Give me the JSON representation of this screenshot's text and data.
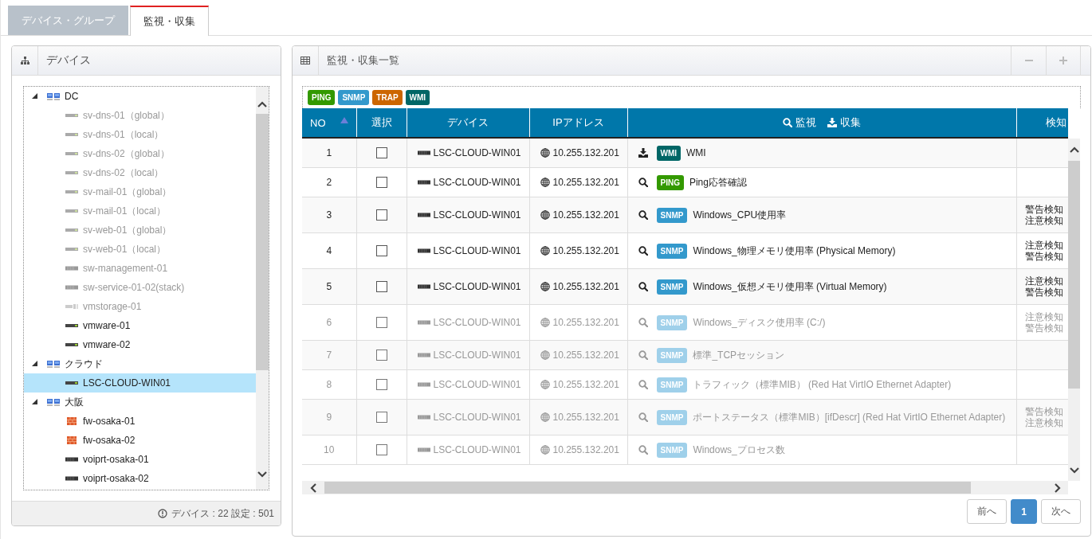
{
  "tabs": [
    {
      "label": "デバイス・グループ",
      "selected": false
    },
    {
      "label": "監視・収集",
      "selected": true
    }
  ],
  "device_panel": {
    "title": "デバイス",
    "tree": [
      {
        "label": "DC",
        "kind": "group",
        "expanded": true,
        "selected": false,
        "disabled": false,
        "children": [
          {
            "label": "sv-dns-01（global）",
            "kind": "server",
            "selected": false,
            "disabled": true
          },
          {
            "label": "sv-dns-01（local）",
            "kind": "server",
            "selected": false,
            "disabled": true
          },
          {
            "label": "sv-dns-02（global）",
            "kind": "server",
            "selected": false,
            "disabled": true
          },
          {
            "label": "sv-dns-02（local）",
            "kind": "server",
            "selected": false,
            "disabled": true
          },
          {
            "label": "sv-mail-01（global）",
            "kind": "server",
            "selected": false,
            "disabled": true
          },
          {
            "label": "sv-mail-01（local）",
            "kind": "server",
            "selected": false,
            "disabled": true
          },
          {
            "label": "sv-web-01（global）",
            "kind": "server",
            "selected": false,
            "disabled": true
          },
          {
            "label": "sv-web-01（local）",
            "kind": "server",
            "selected": false,
            "disabled": true
          },
          {
            "label": "sw-management-01",
            "kind": "switch",
            "selected": false,
            "disabled": true
          },
          {
            "label": "sw-service-01-02(stack)",
            "kind": "switch",
            "selected": false,
            "disabled": true
          },
          {
            "label": "vmstorage-01",
            "kind": "storage",
            "selected": false,
            "disabled": true
          },
          {
            "label": "vmware-01",
            "kind": "server",
            "selected": false,
            "disabled": false
          },
          {
            "label": "vmware-02",
            "kind": "server",
            "selected": false,
            "disabled": false
          }
        ]
      },
      {
        "label": "クラウド",
        "kind": "group",
        "expanded": true,
        "selected": false,
        "disabled": false,
        "children": [
          {
            "label": "LSC-CLOUD-WIN01",
            "kind": "server",
            "selected": true,
            "disabled": false
          }
        ]
      },
      {
        "label": "大阪",
        "kind": "group",
        "expanded": true,
        "selected": false,
        "disabled": false,
        "children": [
          {
            "label": "fw-osaka-01",
            "kind": "firewall",
            "selected": false,
            "disabled": false
          },
          {
            "label": "fw-osaka-02",
            "kind": "firewall",
            "selected": false,
            "disabled": false
          },
          {
            "label": "voiprt-osaka-01",
            "kind": "switch",
            "selected": false,
            "disabled": false
          },
          {
            "label": "voiprt-osaka-02",
            "kind": "switch",
            "selected": false,
            "disabled": false
          }
        ]
      }
    ],
    "footer": "デバイス : 22  設定 : 501"
  },
  "list_panel": {
    "title": "監視・収集一覧",
    "legend": [
      {
        "label": "PING",
        "color": "#339900"
      },
      {
        "label": "SNMP",
        "color": "#3399cc"
      },
      {
        "label": "TRAP",
        "color": "#cc6600"
      },
      {
        "label": "WMI",
        "color": "#006666"
      }
    ],
    "columns": [
      {
        "label": "NO",
        "sorted": true
      },
      {
        "label": "選択",
        "sorted": false
      },
      {
        "label": "デバイス",
        "sorted": false
      },
      {
        "label": "IPアドレス",
        "sorted": false
      },
      {
        "label": "監視",
        "label2": "収集",
        "sorted": false
      },
      {
        "label": "検知",
        "sorted": false
      }
    ],
    "rows": [
      {
        "no": "1",
        "checked": false,
        "device": "LSC-CLOUD-WIN01",
        "ip": "10.255.132.201",
        "kind": "collect",
        "badge": "WMI",
        "name": "WMI",
        "detect": [],
        "disabled": false
      },
      {
        "no": "2",
        "checked": false,
        "device": "LSC-CLOUD-WIN01",
        "ip": "10.255.132.201",
        "kind": "monitor",
        "badge": "PING",
        "name": "Ping応答確認",
        "detect": [],
        "disabled": false
      },
      {
        "no": "3",
        "checked": false,
        "device": "LSC-CLOUD-WIN01",
        "ip": "10.255.132.201",
        "kind": "monitor",
        "badge": "SNMP",
        "name": "Windows_CPU使用率",
        "detect": [
          "警告検知",
          "注意検知"
        ],
        "disabled": false
      },
      {
        "no": "4",
        "checked": false,
        "device": "LSC-CLOUD-WIN01",
        "ip": "10.255.132.201",
        "kind": "monitor",
        "badge": "SNMP",
        "name": "Windows_物理メモリ使用率 (Physical Memory)",
        "detect": [
          "注意検知",
          "警告検知"
        ],
        "disabled": false
      },
      {
        "no": "5",
        "checked": false,
        "device": "LSC-CLOUD-WIN01",
        "ip": "10.255.132.201",
        "kind": "monitor",
        "badge": "SNMP",
        "name": "Windows_仮想メモリ使用率 (Virtual Memory)",
        "detect": [
          "注意検知",
          "警告検知"
        ],
        "disabled": false
      },
      {
        "no": "6",
        "checked": false,
        "device": "LSC-CLOUD-WIN01",
        "ip": "10.255.132.201",
        "kind": "monitor",
        "badge": "SNMP",
        "name": "Windows_ディスク使用率 (C:/)",
        "detect": [
          "注意検知",
          "警告検知"
        ],
        "disabled": true
      },
      {
        "no": "7",
        "checked": false,
        "device": "LSC-CLOUD-WIN01",
        "ip": "10.255.132.201",
        "kind": "monitor",
        "badge": "SNMP",
        "name": "標準_TCPセッション",
        "detect": [],
        "disabled": true
      },
      {
        "no": "8",
        "checked": false,
        "device": "LSC-CLOUD-WIN01",
        "ip": "10.255.132.201",
        "kind": "monitor",
        "badge": "SNMP",
        "name": "トラフィック（標準MIB） (Red Hat VirtIO Ethernet Adapter)",
        "detect": [],
        "disabled": true
      },
      {
        "no": "9",
        "checked": false,
        "device": "LSC-CLOUD-WIN01",
        "ip": "10.255.132.201",
        "kind": "monitor",
        "badge": "SNMP",
        "name": "ポートステータス（標準MIB）[ifDescr] (Red Hat VirtIO Ethernet Adapter)",
        "detect": [
          "警告検知",
          "注意検知"
        ],
        "disabled": true
      },
      {
        "no": "10",
        "checked": false,
        "device": "LSC-CLOUD-WIN01",
        "ip": "10.255.132.201",
        "kind": "monitor",
        "badge": "SNMP",
        "name": "Windows_プロセス数",
        "detect": [],
        "disabled": true
      }
    ],
    "pagination": [
      {
        "label": "前へ",
        "selected": false
      },
      {
        "label": "1",
        "selected": true
      },
      {
        "label": "次へ",
        "selected": false
      }
    ]
  }
}
